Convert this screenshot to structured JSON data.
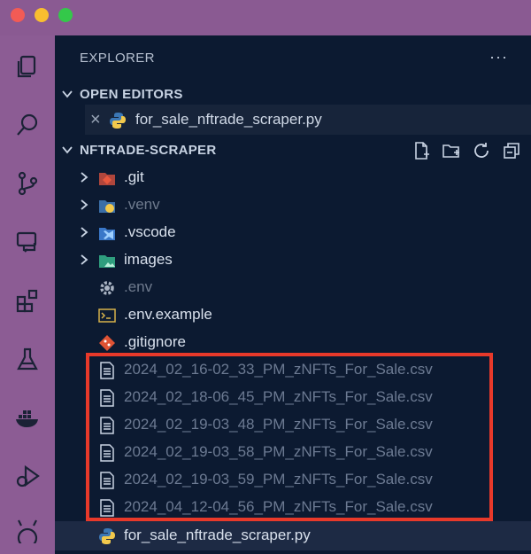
{
  "explorer": {
    "title": "EXPLORER",
    "more": "···"
  },
  "open_editors": {
    "title": "OPEN EDITORS",
    "items": [
      {
        "name": "for_sale_nftrade_scraper.py"
      }
    ]
  },
  "project": {
    "title": "NFTRADE-SCRAPER",
    "files": [
      {
        "name": ".git",
        "kind": "folder",
        "icon": "git-folder-icon"
      },
      {
        "name": ".venv",
        "kind": "folder",
        "icon": "python-folder-icon"
      },
      {
        "name": ".vscode",
        "kind": "folder",
        "icon": "vscode-folder-icon"
      },
      {
        "name": "images",
        "kind": "folder",
        "icon": "images-folder-icon"
      },
      {
        "name": ".env",
        "kind": "file",
        "icon": "gear-icon"
      },
      {
        "name": ".env.example",
        "kind": "file",
        "icon": "terminal-icon"
      },
      {
        "name": ".gitignore",
        "kind": "file",
        "icon": "git-icon"
      },
      {
        "name": "2024_02_16-02_33_PM_zNFTs_For_Sale.csv",
        "kind": "file",
        "icon": "csv-file-icon"
      },
      {
        "name": "2024_02_18-06_45_PM_zNFTs_For_Sale.csv",
        "kind": "file",
        "icon": "csv-file-icon"
      },
      {
        "name": "2024_02_19-03_48_PM_zNFTs_For_Sale.csv",
        "kind": "file",
        "icon": "csv-file-icon"
      },
      {
        "name": "2024_02_19-03_58_PM_zNFTs_For_Sale.csv",
        "kind": "file",
        "icon": "csv-file-icon"
      },
      {
        "name": "2024_02_19-03_59_PM_zNFTs_For_Sale.csv",
        "kind": "file",
        "icon": "csv-file-icon"
      },
      {
        "name": "2024_04_12-04_56_PM_zNFTs_For_Sale.csv",
        "kind": "file",
        "icon": "csv-file-icon"
      },
      {
        "name": "for_sale_nftrade_scraper.py",
        "kind": "file",
        "icon": "python-file-icon"
      }
    ]
  },
  "colors": {
    "activity_bar": "#8c5c94",
    "sidebar": "#0c1a31",
    "highlight": "#e8392a"
  }
}
